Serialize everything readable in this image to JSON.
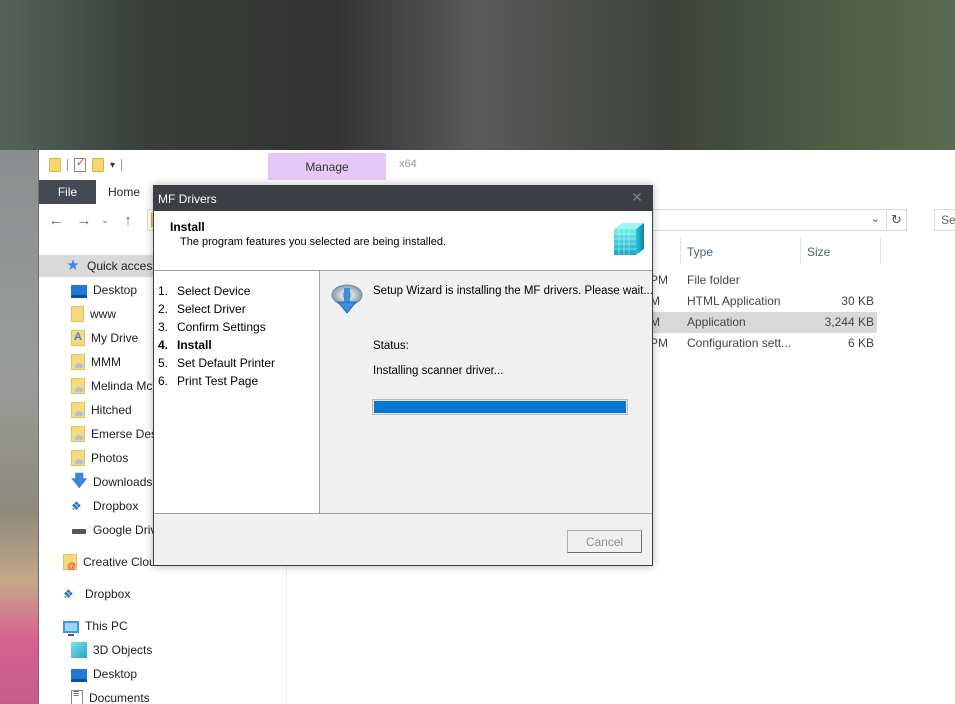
{
  "explorer": {
    "quick_access_toolbar": {
      "icons": [
        "folder-icon",
        "properties-icon",
        "new-folder-icon",
        "customize-dropdown-icon"
      ]
    },
    "contextual_tab": "Manage",
    "contextual_group": "x64",
    "ribbon_tabs": [
      "File",
      "Home"
    ],
    "nav": {
      "back": "←",
      "forward": "→",
      "recent": "⌄",
      "up": "↑",
      "address_chevron": "⌄",
      "refresh": "↻",
      "search_placeholder": "Se"
    },
    "sidebar": [
      {
        "label": "Quick access",
        "icon": "star-icon",
        "selected": true
      },
      {
        "label": "Desktop",
        "icon": "desktop-icon"
      },
      {
        "label": "www",
        "icon": "folder-icon"
      },
      {
        "label": "My Drive",
        "icon": "google-drive-folder-icon"
      },
      {
        "label": "MMM",
        "icon": "shared-folder-icon"
      },
      {
        "label": "Melinda Mc",
        "icon": "shared-folder-icon"
      },
      {
        "label": "Hitched",
        "icon": "shared-folder-icon"
      },
      {
        "label": "Emerse Desi",
        "icon": "shared-folder-icon"
      },
      {
        "label": "Photos",
        "icon": "shared-folder-icon"
      },
      {
        "label": "Downloads",
        "icon": "downloads-icon"
      },
      {
        "label": "Dropbox",
        "icon": "dropbox-icon"
      },
      {
        "label": "Google Driv",
        "icon": "drive-icon"
      },
      {
        "label": "Creative Cloud Files",
        "icon": "creative-cloud-icon"
      },
      {
        "label": "Dropbox",
        "icon": "dropbox-icon"
      },
      {
        "label": "This PC",
        "icon": "this-pc-icon"
      },
      {
        "label": "3D Objects",
        "icon": "3d-objects-icon"
      },
      {
        "label": "Desktop",
        "icon": "desktop-icon"
      },
      {
        "label": "Documents",
        "icon": "documents-icon"
      }
    ],
    "columns": {
      "type": "Type",
      "size": "Size"
    },
    "files": [
      {
        "date_fragment": "PM",
        "type": "File folder",
        "size": "",
        "selected": false
      },
      {
        "date_fragment": "M",
        "type": "HTML Application",
        "size": "30 KB",
        "selected": false
      },
      {
        "date_fragment": "M",
        "type": "Application",
        "size": "3,244 KB",
        "selected": true
      },
      {
        "date_fragment": "PM",
        "type": "Configuration sett...",
        "size": "6 KB",
        "selected": false
      }
    ]
  },
  "dialog": {
    "title": "MF Drivers",
    "close": "✕",
    "header_title": "Install",
    "header_subtitle": "The program features you selected are being installed.",
    "steps": [
      {
        "num": "1.",
        "label": "Select Device",
        "current": false
      },
      {
        "num": "2.",
        "label": "Select Driver",
        "current": false
      },
      {
        "num": "3.",
        "label": "Confirm Settings",
        "current": false
      },
      {
        "num": "4.",
        "label": "Install",
        "current": true
      },
      {
        "num": "5.",
        "label": "Set Default Printer",
        "current": false
      },
      {
        "num": "6.",
        "label": "Print Test Page",
        "current": false
      }
    ],
    "message": "Setup Wizard is installing the MF drivers. Please wait...",
    "status_label": "Status:",
    "status_value": "Installing scanner driver...",
    "progress_percent": 100,
    "progress_color": "#0678d4",
    "cancel_label": "Cancel",
    "cancel_enabled": false
  }
}
